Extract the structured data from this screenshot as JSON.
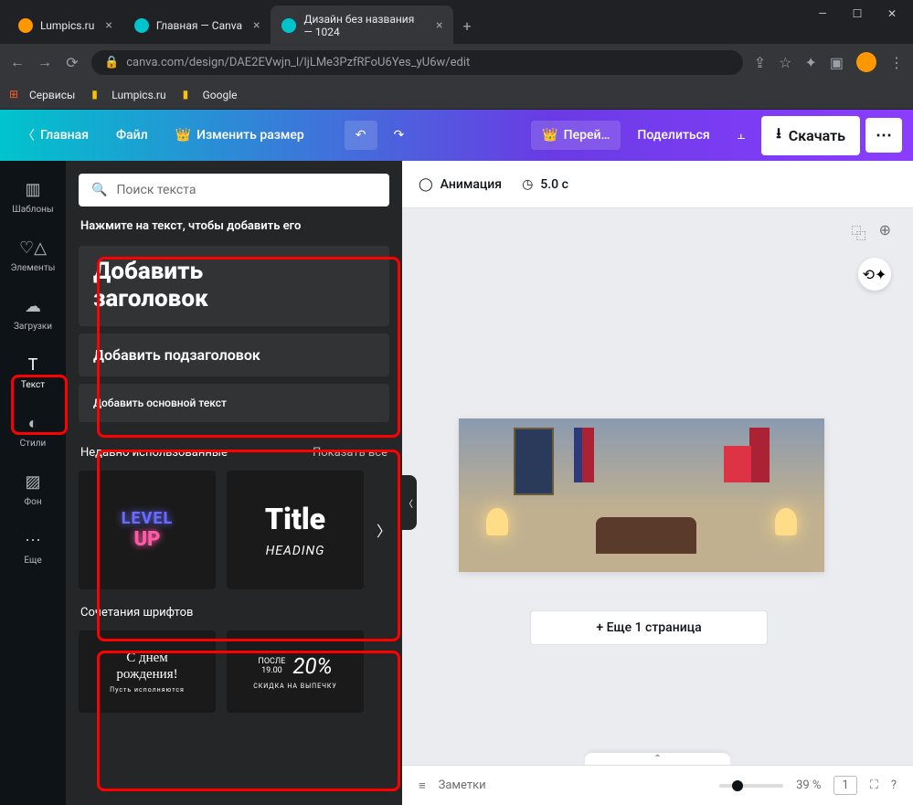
{
  "browser": {
    "tabs": [
      {
        "title": "Lumpics.ru",
        "favicon": "#ff9800"
      },
      {
        "title": "Главная — Canva",
        "favicon": "#00c4cc"
      },
      {
        "title": "Дизайн без названия — 1024",
        "favicon": "#00c4cc"
      }
    ],
    "url": "canva.com/design/DAE2EVwjn_l/ljLMe3PzfRFoU6Yes_yU6w/edit",
    "bookmarks": [
      {
        "label": "Сервисы"
      },
      {
        "label": "Lumpics.ru"
      },
      {
        "label": "Google"
      }
    ]
  },
  "header": {
    "home": "Главная",
    "file": "Файл",
    "resize": "Изменить размер",
    "upgrade": "Перей…",
    "share": "Поделиться",
    "download": "Скачать"
  },
  "left_nav": {
    "items": [
      {
        "label": "Шаблоны"
      },
      {
        "label": "Элементы"
      },
      {
        "label": "Загрузки"
      },
      {
        "label": "Текст"
      },
      {
        "label": "Стили"
      },
      {
        "label": "Фон"
      },
      {
        "label": "Еще"
      }
    ]
  },
  "panel": {
    "search_placeholder": "Поиск текста",
    "hint": "Нажмите на текст, чтобы добавить его",
    "add_heading_l1": "Добавить",
    "add_heading_l2": "заголовок",
    "add_sub": "Добавить подзаголовок",
    "add_body": "Добавить основной текст",
    "recent_hdr": "Недавно использованные",
    "show_all": "Показать все",
    "recent_thumbs": {
      "t1a": "LEVEL",
      "t1b": "UP",
      "t2a": "Title",
      "t2b": "HEADING"
    },
    "combos_hdr": "Сочетания шрифтов",
    "combo1a": "С днем",
    "combo1b": "рождения!",
    "combo1c": "Пусть исполняются",
    "combo2a": "ПОСЛЕ",
    "combo2b": "19.00",
    "combo2c": "20%",
    "combo2d": "СКИДКА НА ВЫПЕЧКУ"
  },
  "canvas": {
    "animation": "Анимация",
    "duration": "5.0 с",
    "add_page": "+ Еще 1 страница"
  },
  "footer": {
    "notes": "Заметки",
    "zoom": "39 %",
    "page_count": "1"
  }
}
